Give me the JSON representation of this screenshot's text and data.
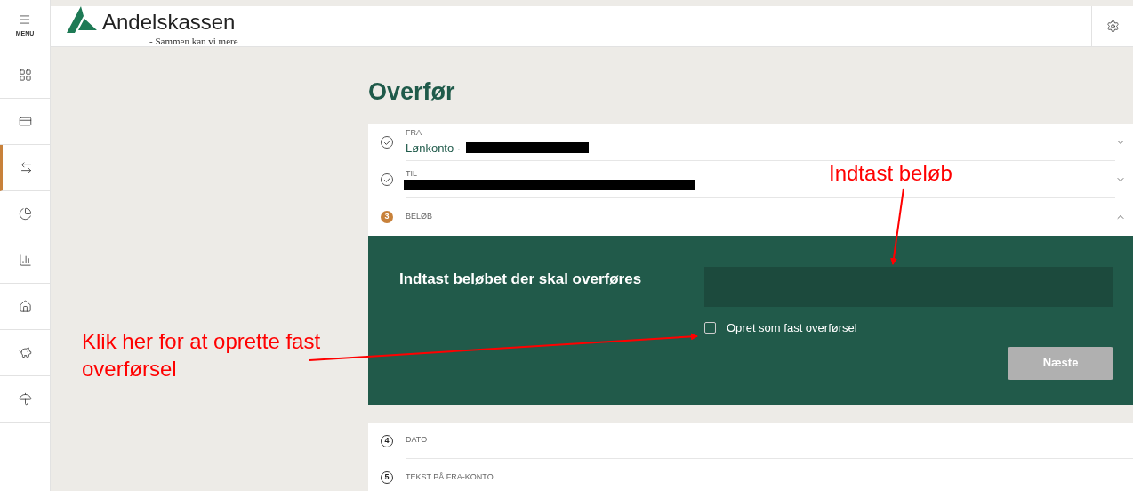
{
  "header": {
    "menu_label": "MENU",
    "brand": "Andelskassen",
    "tagline": "- Sammen kan vi mere"
  },
  "sidebar": {
    "items": [
      {
        "selected": false
      },
      {
        "selected": false
      },
      {
        "selected": true
      },
      {
        "selected": false
      },
      {
        "selected": false
      },
      {
        "selected": false
      },
      {
        "selected": false
      },
      {
        "selected": false
      }
    ]
  },
  "page": {
    "title": "Overfør"
  },
  "steps": [
    {
      "kind": "done",
      "label": "FRA",
      "value": "Lønkonto ·",
      "redacted": true,
      "expanded": false
    },
    {
      "kind": "done",
      "label": "TIL",
      "redacted": true,
      "expanded": false
    },
    {
      "kind": "current",
      "number": "3",
      "label": "BELØB",
      "expanded": true
    }
  ],
  "amount_panel": {
    "prompt": "Indtast beløbet der skal overføres",
    "checkbox": {
      "label": "Opret som fast overførsel",
      "checked": false
    },
    "next_button": {
      "label": "Næste",
      "disabled": true
    }
  },
  "later_steps": [
    {
      "kind": "pending",
      "number": "4",
      "label": "DATO"
    },
    {
      "kind": "pending",
      "number": "5",
      "label": "TEKST PÅ FRA-KONTO"
    }
  ],
  "annotations": [
    {
      "text": "Indtast beløb"
    },
    {
      "text": "Klik her for at oprette fast overførsel"
    }
  ]
}
